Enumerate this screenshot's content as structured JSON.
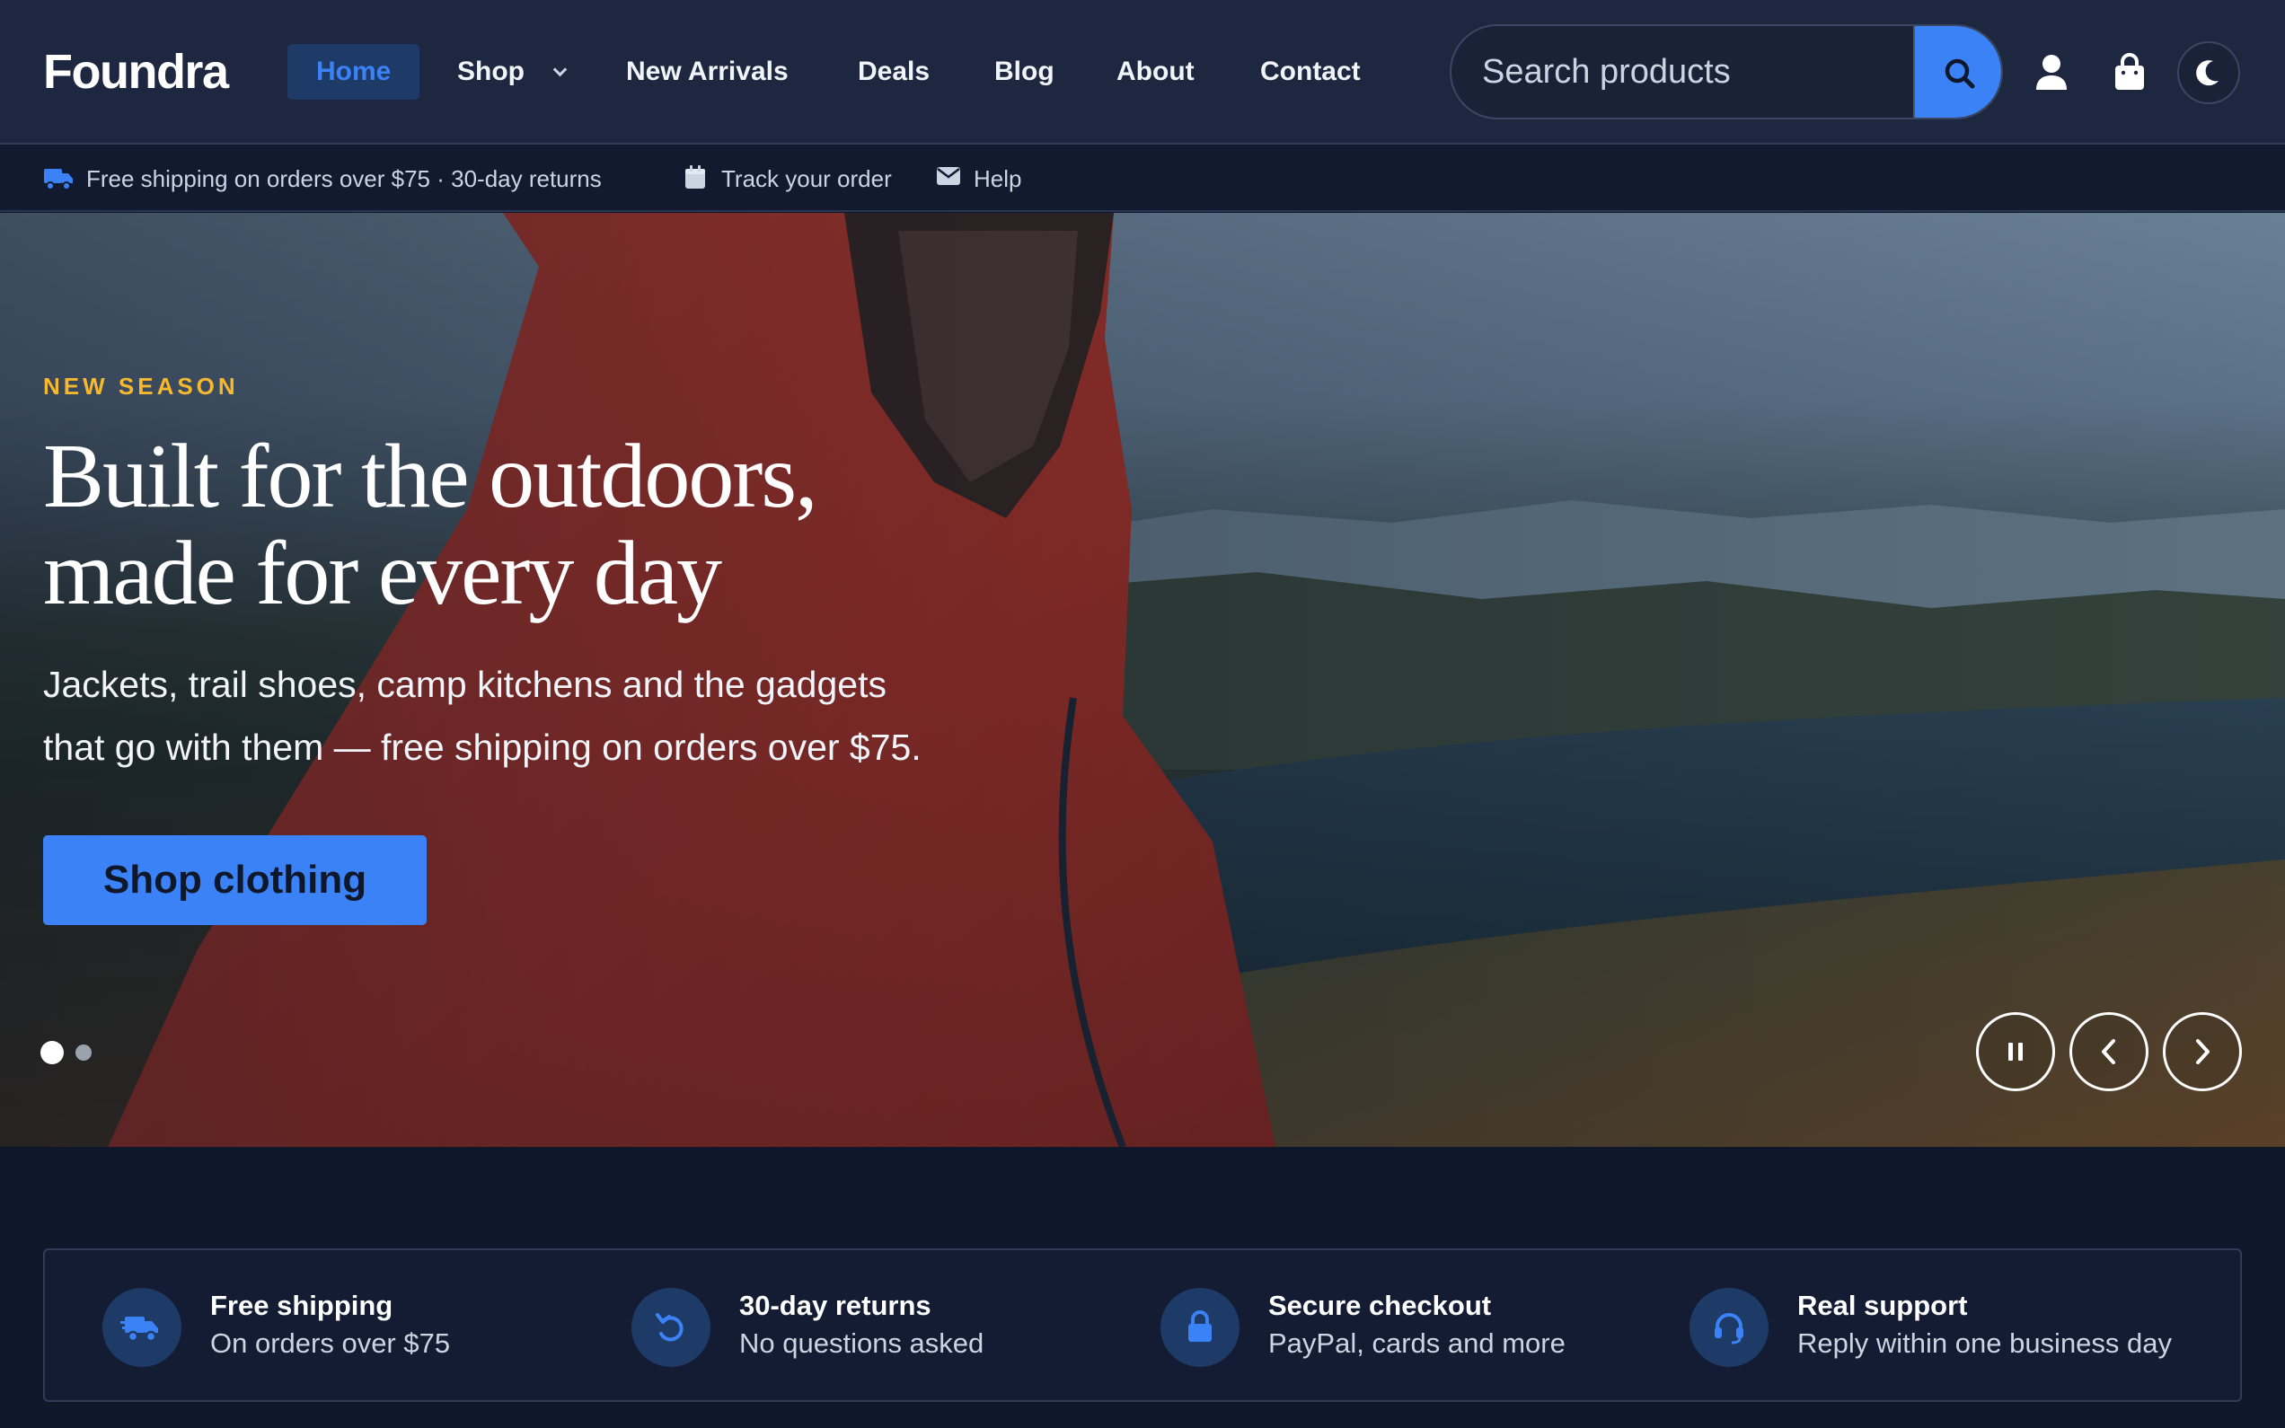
{
  "brand": {
    "name": "Foundra"
  },
  "nav": {
    "items": [
      {
        "label": "Home",
        "active": true
      },
      {
        "label": "Shop",
        "has_dropdown": true
      },
      {
        "label": "New Arrivals"
      },
      {
        "label": "Deals"
      },
      {
        "label": "Blog"
      },
      {
        "label": "About"
      },
      {
        "label": "Contact"
      }
    ]
  },
  "search": {
    "placeholder": "Search products",
    "value": ""
  },
  "header_icons": [
    "search-icon",
    "user-icon",
    "shopping-bag-icon",
    "moon-icon"
  ],
  "utility_bar": {
    "shipping": "Free shipping on orders over $75 · 30-day returns",
    "track": "Track your order",
    "help": "Help",
    "icons": [
      "truck-icon",
      "calendar-icon",
      "envelope-icon"
    ]
  },
  "hero": {
    "eyebrow": "NEW SEASON",
    "title_line1": "Built for the outdoors,",
    "title_line2": "made for every day",
    "subtitle_line1": "Jackets, trail shoes, camp kitchens and the gadgets",
    "subtitle_line2": "that go with them — free shipping on orders over $75.",
    "cta": "Shop clothing",
    "slides_total": 2,
    "active_slide": 1,
    "controls": [
      "pause-icon",
      "chevron-left-icon",
      "chevron-right-icon"
    ]
  },
  "features": [
    {
      "icon": "truck-icon",
      "title": "Free shipping",
      "desc": "On orders over $75"
    },
    {
      "icon": "rotate-left-icon",
      "title": "30-day returns",
      "desc": "No questions asked"
    },
    {
      "icon": "lock-icon",
      "title": "Secure checkout",
      "desc": "PayPal, cards and more"
    },
    {
      "icon": "headset-icon",
      "title": "Real support",
      "desc": "Reply within one business day"
    }
  ],
  "colors": {
    "accent": "#3b82f6",
    "eyebrow": "#f5b82e",
    "header_bg": "#1e2740",
    "page_bg": "#0f172a"
  }
}
